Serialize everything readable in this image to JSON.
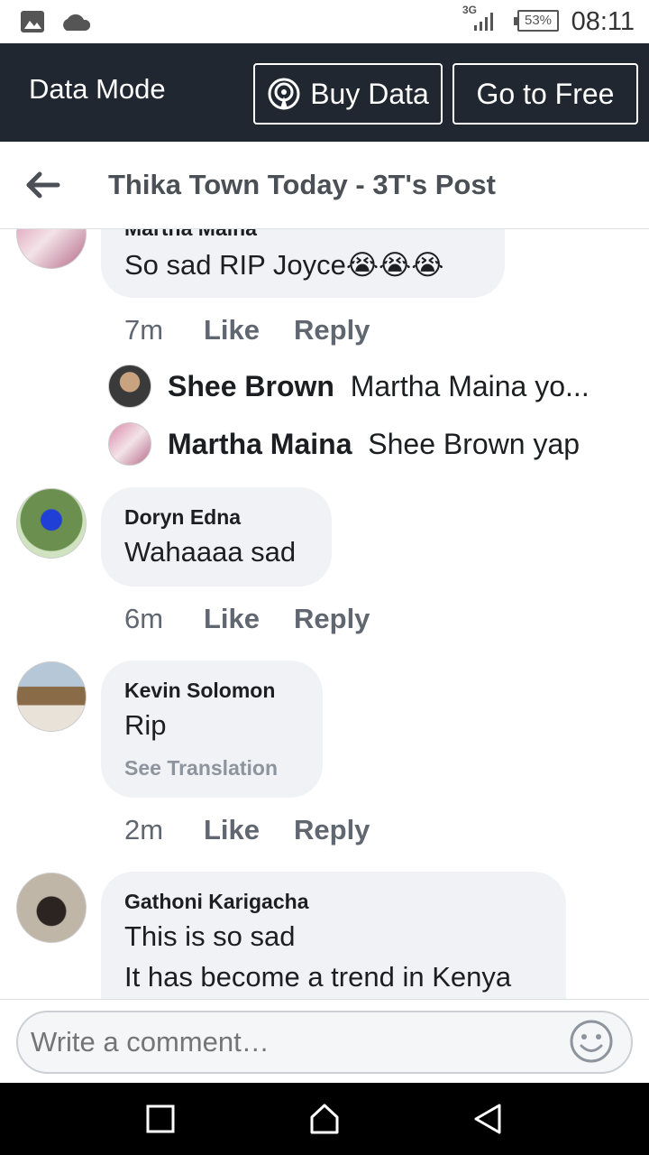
{
  "status_bar": {
    "network": "3G",
    "battery": "53%",
    "time": "08:11"
  },
  "data_mode": {
    "title": "Data Mode",
    "buy_label": "Buy Data",
    "free_label": "Go to Free"
  },
  "header": {
    "title": "Thika Town Today - 3T's Post"
  },
  "comments": [
    {
      "author": "Martha Maina",
      "text": "So sad RIP Joyce😭😭😭",
      "time": "7m",
      "like": "Like",
      "reply": "Reply",
      "replies": [
        {
          "author": "Shee Brown",
          "text": "Martha Maina yo..."
        },
        {
          "author": "Martha Maina",
          "text": "Shee Brown yap"
        }
      ]
    },
    {
      "author": "Doryn Edna",
      "text": "Wahaaaa sad",
      "time": "6m",
      "like": "Like",
      "reply": "Reply"
    },
    {
      "author": "Kevin Solomon",
      "text": "Rip",
      "translation": "See Translation",
      "time": "2m",
      "like": "Like",
      "reply": "Reply"
    },
    {
      "author": "Gathoni Karigacha",
      "text_line1": "This is so sad",
      "text_line2": "It has become a trend in Kenya"
    }
  ],
  "composer": {
    "placeholder": "Write a comment…"
  }
}
